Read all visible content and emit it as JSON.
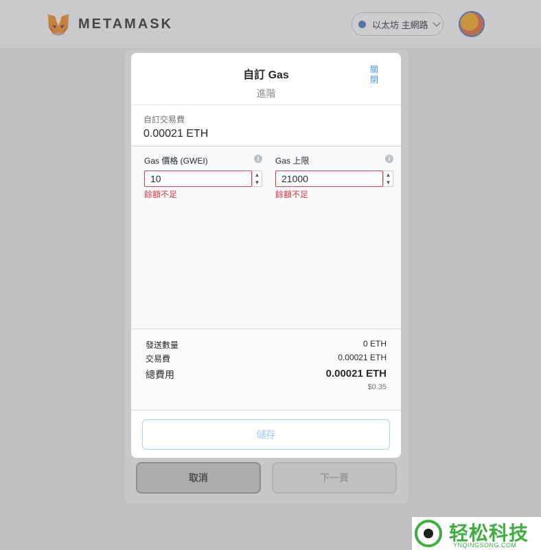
{
  "app": {
    "logo_text": "METAMASK",
    "network_label": "以太坊 主網路",
    "colors": {
      "accent": "#3d9ae4",
      "error": "#d73a49",
      "network_dot": "#3a78c9"
    }
  },
  "background": {
    "cancel_label": "取消",
    "next_label": "下一頁"
  },
  "modal": {
    "title": "自訂 Gas",
    "subtitle": "進階",
    "close_label": "關閉",
    "fee_label": "自訂交易費",
    "fee_value": "0.00021 ETH",
    "gas_price": {
      "label": "Gas 價格 (GWEI)",
      "value": "10",
      "error": "餘額不足"
    },
    "gas_limit": {
      "label": "Gas 上限",
      "value": "21000",
      "error": "餘額不足"
    },
    "summary": {
      "send_amount_label": "發送數量",
      "send_amount_value": "0 ETH",
      "tx_fee_label": "交易費",
      "tx_fee_value": "0.00021 ETH",
      "total_label": "總費用",
      "total_value": "0.00021 ETH",
      "total_fiat": "$0.35"
    },
    "save_label": "儲存"
  },
  "watermark": {
    "text": "轻松科技",
    "sub": "YNQINGSONG.COM"
  }
}
